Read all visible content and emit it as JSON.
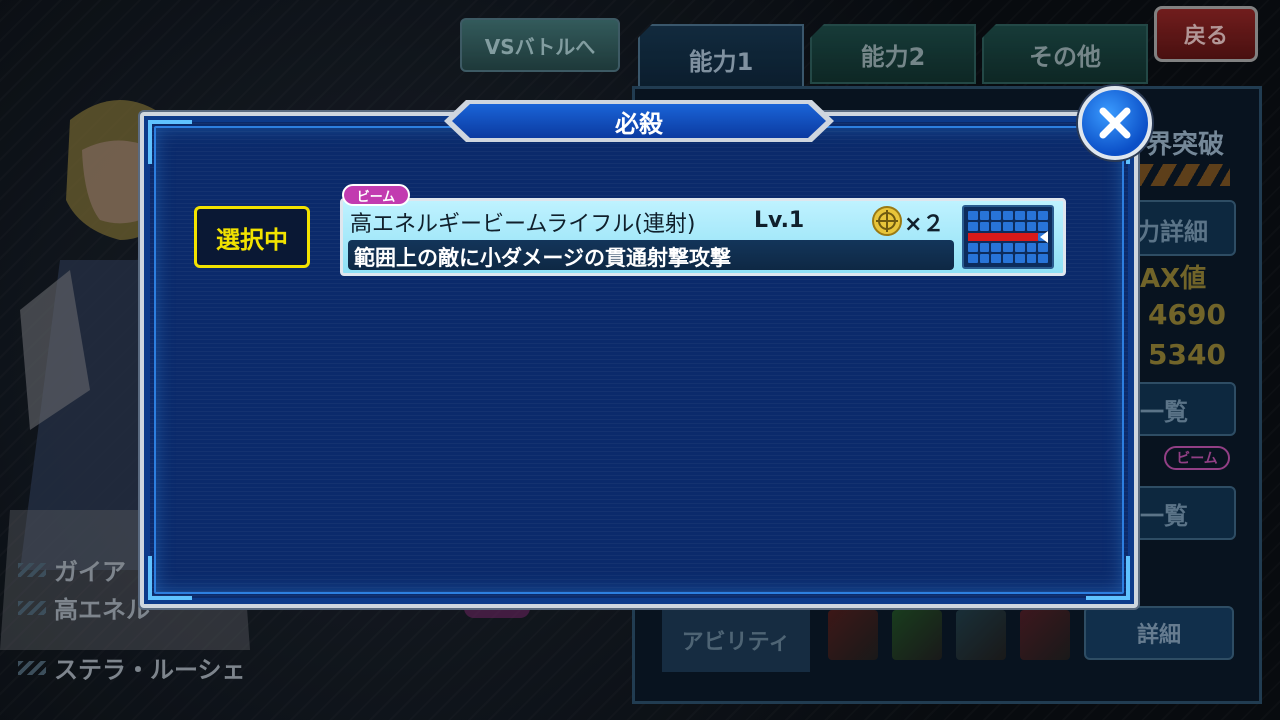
{
  "background": {
    "vs_button_label": "VSバトルへ",
    "back_button_label": "戻る",
    "tabs": [
      "能力1",
      "能力2",
      "その他"
    ],
    "right_panel": {
      "limit_break_label": "界突破",
      "detail_label": "力詳細",
      "max_label": "AX値",
      "value_1": "4690",
      "value_2": "5340",
      "list_label_1": "一覧",
      "list_label_2": "一覧",
      "beam_badge": "ビーム",
      "ability_label": "アビリティ",
      "ability_detail_label": "詳細"
    },
    "left_labels": {
      "unit": "ガイア",
      "weapon": "高エネル",
      "pilot": "ステラ・ルーシェ"
    }
  },
  "modal": {
    "title": "必殺",
    "selected_badge": "選択中",
    "skill": {
      "tag": "ビーム",
      "name": "高エネルギービームライフル(連射)",
      "level": "Lv.1",
      "cost": "×２",
      "description": "範囲上の敵に小ダメージの貫通射撃攻撃"
    }
  },
  "colors": {
    "modal_bg": "#0b2a6b",
    "selected_badge": "#f2e200",
    "beam_tag": "#c23bb0",
    "close_button": "#1a7bf0"
  }
}
